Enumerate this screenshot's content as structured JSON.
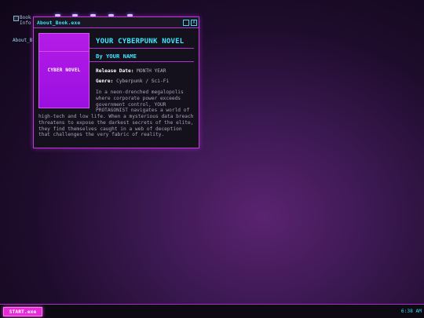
{
  "desktop": {
    "icon_alt_text": "Book\nInfo",
    "icon_label": "About_B"
  },
  "window": {
    "title": "About_Book.exe",
    "minimize_symbol": "",
    "close_symbol": "X"
  },
  "book": {
    "cover_text": "CYBER NOVEL",
    "title": "YOUR CYBERPUNK NOVEL",
    "author": "By YOUR NAME",
    "release_label": "Release Date:",
    "release_value": "MONTH YEAR",
    "genre_label": "Genre:",
    "genre_value": "Cyberpunk / Sci-Fi",
    "synopsis": "In a neon-drenched megalopolis where corporate power exceeds government control, YOUR PROTAGONIST navigates a world of high-tech and low life. When a mysterious data breach threatens to expose the darkest secrets of the elite, they find themselves caught in a web of deception that challenges the very fabric of reality."
  },
  "taskbar": {
    "start_label": "START.exe",
    "clock": "6:38 AM"
  },
  "colors": {
    "accent_cyan": "#3fe6ff",
    "accent_magenta": "#e62cd9",
    "window_border": "#c236e0",
    "cover_purple": "#a514e4"
  },
  "icons": {
    "desktop_icon": "broken-image-icon",
    "minimize": "minimize-icon",
    "close": "close-icon"
  }
}
